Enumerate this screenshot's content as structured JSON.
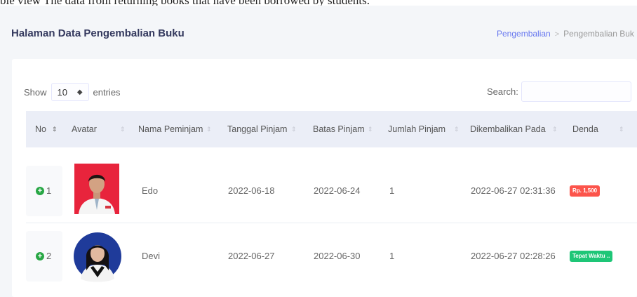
{
  "top_fragment": "ble view The data from returning books that have been borrowed by students.",
  "header": {
    "title": "Halaman Data Pengembalian Buku",
    "breadcrumb": {
      "link": "Pengembalian",
      "separator": ">",
      "current": "Pengembalian Buk"
    }
  },
  "controls": {
    "show_label": "Show",
    "entries_value": "10",
    "entries_arrow": "◆",
    "entries_label": "entries",
    "search_label": "Search:",
    "search_value": ""
  },
  "table": {
    "sort_glyph": "⇕",
    "columns": [
      {
        "label": "No",
        "sorted": true
      },
      {
        "label": "Avatar",
        "sorted": false
      },
      {
        "label": "Nama Peminjam",
        "sorted": false
      },
      {
        "label": "Tanggal Pinjam",
        "sorted": false
      },
      {
        "label": "Batas Pinjam",
        "sorted": false
      },
      {
        "label": "Jumlah Pinjam",
        "sorted": false
      },
      {
        "label": "Dikembalikan Pada",
        "sorted": false
      },
      {
        "label": "Denda",
        "sorted": false
      }
    ],
    "rows": [
      {
        "expand_icon": "+",
        "no": "1",
        "avatar": "photo-red-background",
        "nama": "Edo",
        "tanggal_pinjam": "2022-06-18",
        "batas_pinjam": "2022-06-24",
        "jumlah_pinjam": "1",
        "dikembalikan_pada": "2022-06-27 02:31:36",
        "denda": "Rp. 1,500",
        "denda_color": "#fc544b"
      },
      {
        "expand_icon": "+",
        "no": "2",
        "avatar": "photo-blue-background",
        "nama": "Devi",
        "tanggal_pinjam": "2022-06-27",
        "batas_pinjam": "2022-06-30",
        "jumlah_pinjam": "1",
        "dikembalikan_pada": "2022-06-27 02:28:26",
        "denda": "Tepat Waktu ..",
        "denda_color": "#1ec677"
      }
    ]
  },
  "colors": {
    "accent": "#6777ef",
    "header_bg": "#ebeef7",
    "success": "#28a745"
  }
}
